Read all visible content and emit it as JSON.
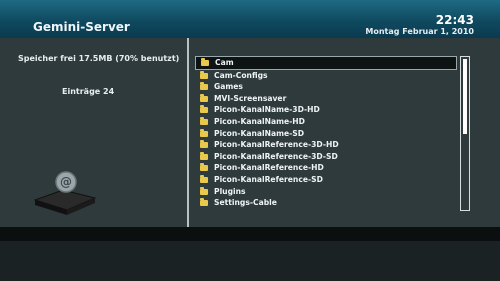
{
  "header": {
    "title": "Gemini-Server",
    "time": "22:43",
    "date": "Montag Februar 1, 2010"
  },
  "info": {
    "space": "Speicher frei 17.5MB (70% benutzt)",
    "entries": "Einträge 24"
  },
  "icons": {
    "device": "receiver-box-icon",
    "folder": "folder-icon"
  },
  "list": {
    "selected_index": 0,
    "items": [
      "Cam",
      "Cam-Configs",
      "Games",
      "MVI-Screensaver",
      "Picon-KanalName-3D-HD",
      "Picon-KanalName-HD",
      "Picon-KanalName-SD",
      "Picon-KanalReference-3D-HD",
      "Picon-KanalReference-3D-SD",
      "Picon-KanalReference-HD",
      "Picon-KanalReference-SD",
      "Plugins",
      "Settings-Cable"
    ],
    "scroll_fraction": 0.5
  },
  "colors": {
    "header": "#0f4a60",
    "panel": "#2f3a3d",
    "folder": "#e9c94c"
  }
}
